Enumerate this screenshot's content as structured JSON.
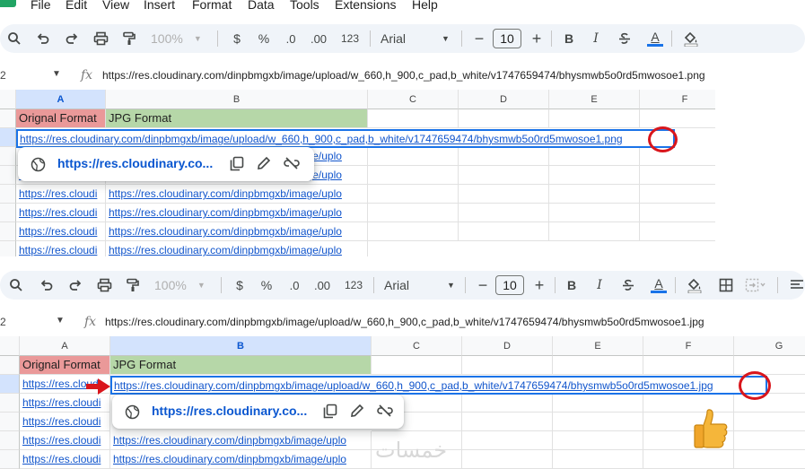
{
  "menu": [
    "File",
    "Edit",
    "View",
    "Insert",
    "Format",
    "Data",
    "Tools",
    "Extensions",
    "Help"
  ],
  "toolbar": {
    "zoom": "100%",
    "currency": "$",
    "percent": "%",
    "dec_decrease": ".0",
    "dec_increase": ".00",
    "number_format": "123",
    "font": "Arial",
    "font_size": "10",
    "minus": "−",
    "plus": "+",
    "bold": "B",
    "italic": "I",
    "text_color": "A"
  },
  "top": {
    "name_box": "2",
    "formula": "https://res.cloudinary.com/dinpbmgxb/image/upload/w_660,h_900,c_pad,b_white/v1747659474/bhysmwb5o0rd5mwosoe1.png",
    "columns": [
      "A",
      "B",
      "C",
      "D",
      "E",
      "F"
    ],
    "header_a": "Orignal Format",
    "header_b": "JPG Format",
    "active_value": "https://res.cloudinary.com/dinpbmgxb/image/upload/w_660,h_900,c_pad,b_white/v1747659474/bhysmwb5o0rd5mwosoe1.png",
    "popup_link": "https://res.cloudinary.co...",
    "cell_a": "https://res.cloudi",
    "cell_b": "https://res.cloudinary.com/dinpbmgxb/image/uplo"
  },
  "bottom": {
    "name_box": "2",
    "formula": "https://res.cloudinary.com/dinpbmgxb/image/upload/w_660,h_900,c_pad,b_white/v1747659474/bhysmwb5o0rd5mwosoe1.jpg",
    "columns": [
      "A",
      "B",
      "C",
      "D",
      "E",
      "F",
      "G"
    ],
    "header_a": "Orignal Format",
    "header_b": "JPG Format",
    "active_value": "https://res.cloudinary.com/dinpbmgxb/image/upload/w_660,h_900,c_pad,b_white/v1747659474/bhysmwb5o0rd5mwosoe1.jpg",
    "popup_link": "https://res.cloudinary.co...",
    "cell_a": "https://res.cloudi",
    "cell_b": "https://res.cloudinary.com/dinpbmgxb/image/uplo"
  },
  "watermark": "خمسات",
  "colors": {
    "accent_blue": "#1a73e8",
    "link": "#1155cc",
    "header_red": "#ea9999",
    "header_green": "#b6d7a8",
    "annotation_red": "#d9161c"
  }
}
